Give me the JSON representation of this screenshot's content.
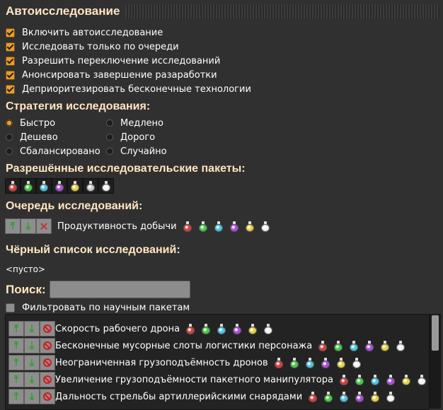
{
  "window": {
    "title": "Автоисследование"
  },
  "options": [
    {
      "label": "Включить автоисследование",
      "checked": true
    },
    {
      "label": "Исследовать только по очереди",
      "checked": true
    },
    {
      "label": "Разрешить переключение исследований",
      "checked": true
    },
    {
      "label": "Анонсировать завершение разаработки",
      "checked": true
    },
    {
      "label": "Деприоритезировать бесконечные технологии",
      "checked": true
    }
  ],
  "strategy": {
    "heading": "Стратегия исследования:",
    "options": [
      {
        "label": "Быстро",
        "selected": true
      },
      {
        "label": "Дешево",
        "selected": false
      },
      {
        "label": "Сбалансировано",
        "selected": false
      },
      {
        "label": "Медлено",
        "selected": false
      },
      {
        "label": "Дорого",
        "selected": false
      },
      {
        "label": "Случайно",
        "selected": false
      }
    ]
  },
  "packs": {
    "heading": "Разрешённые исследовательские пакеты:",
    "colors": [
      "#e03a3a",
      "#3fd13f",
      "#47c7e6",
      "#b04ae6",
      "#e6d23a",
      "#c9c9c9",
      "#f2f2f2"
    ]
  },
  "queue": {
    "heading": "Очередь исследований:",
    "item": {
      "label": "Продуктивность добычи",
      "packs": [
        "#e03a3a",
        "#3fd13f",
        "#47c7e6",
        "#b04ae6",
        "#e6d23a",
        "#f2f2f2"
      ]
    }
  },
  "blacklist": {
    "heading": "Чёрный список исследований:",
    "empty": "<пусто>"
  },
  "search": {
    "label": "Поиск:",
    "value": "",
    "filter_label": "Фильтровать по научным пакетам"
  },
  "techs": [
    {
      "label": "Скорость рабочего дрона",
      "packs": [
        "#e03a3a",
        "#3fd13f",
        "#47c7e6",
        "#b04ae6",
        "#e6d23a",
        "#f2f2f2"
      ]
    },
    {
      "label": "Бесконечные мусорные слоты логистики персонажа",
      "packs": [
        "#e03a3a",
        "#3fd13f",
        "#47c7e6",
        "#b04ae6",
        "#e6d23a",
        "#f2f2f2"
      ]
    },
    {
      "label": "Неограниченная грузоподъёмность дронов",
      "packs": [
        "#e03a3a",
        "#3fd13f",
        "#47c7e6",
        "#b04ae6",
        "#e6d23a",
        "#f2f2f2"
      ]
    },
    {
      "label": "Увеличение грузоподъёмности пакетного манипулятора",
      "packs": [
        "#e03a3a",
        "#3fd13f",
        "#47c7e6",
        "#b04ae6",
        "#e6d23a",
        "#f2f2f2"
      ]
    },
    {
      "label": "Дальность стрельбы артиллерийскими снарядами",
      "packs": [
        "#e03a3a",
        "#3fd13f",
        "#47c7e6",
        "#b04ae6",
        "#e6d23a",
        "#f2f2f2"
      ]
    }
  ]
}
